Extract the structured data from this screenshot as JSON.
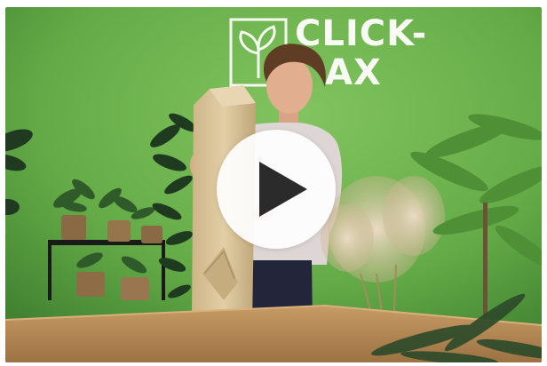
{
  "video": {
    "brand_logo_text": "CLICK-",
    "brand_logo_text_line2": "AX",
    "play_icon": "play-icon",
    "colors": {
      "wall": "#6fb24f",
      "table": "#b78c58",
      "box": "#d8c39b",
      "play_button": "#ffffff",
      "play_triangle": "#2b2b2b"
    }
  }
}
